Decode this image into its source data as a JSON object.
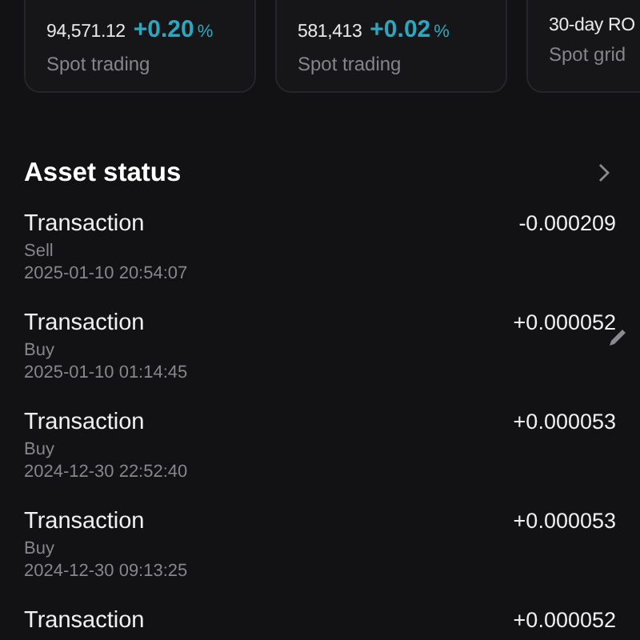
{
  "cards": [
    {
      "value": "94,571.12",
      "change": "+0.20",
      "unit": "%",
      "label": "Spot trading"
    },
    {
      "value": "581,413",
      "change": "+0.02",
      "unit": "%",
      "label": "Spot trading"
    },
    {
      "value": "30-day RO",
      "label": "Spot grid"
    }
  ],
  "asset_status": {
    "title": "Asset status",
    "transactions": [
      {
        "title": "Transaction",
        "amount": "-0.000209",
        "type": "Sell",
        "time": "2025-01-10 20:54:07"
      },
      {
        "title": "Transaction",
        "amount": "+0.000052",
        "type": "Buy",
        "time": "2025-01-10 01:14:45"
      },
      {
        "title": "Transaction",
        "amount": "+0.000053",
        "type": "Buy",
        "time": "2024-12-30 22:52:40"
      },
      {
        "title": "Transaction",
        "amount": "+0.000053",
        "type": "Buy",
        "time": "2024-12-30 09:13:25"
      },
      {
        "title": "Transaction",
        "amount": "+0.000052"
      }
    ]
  }
}
